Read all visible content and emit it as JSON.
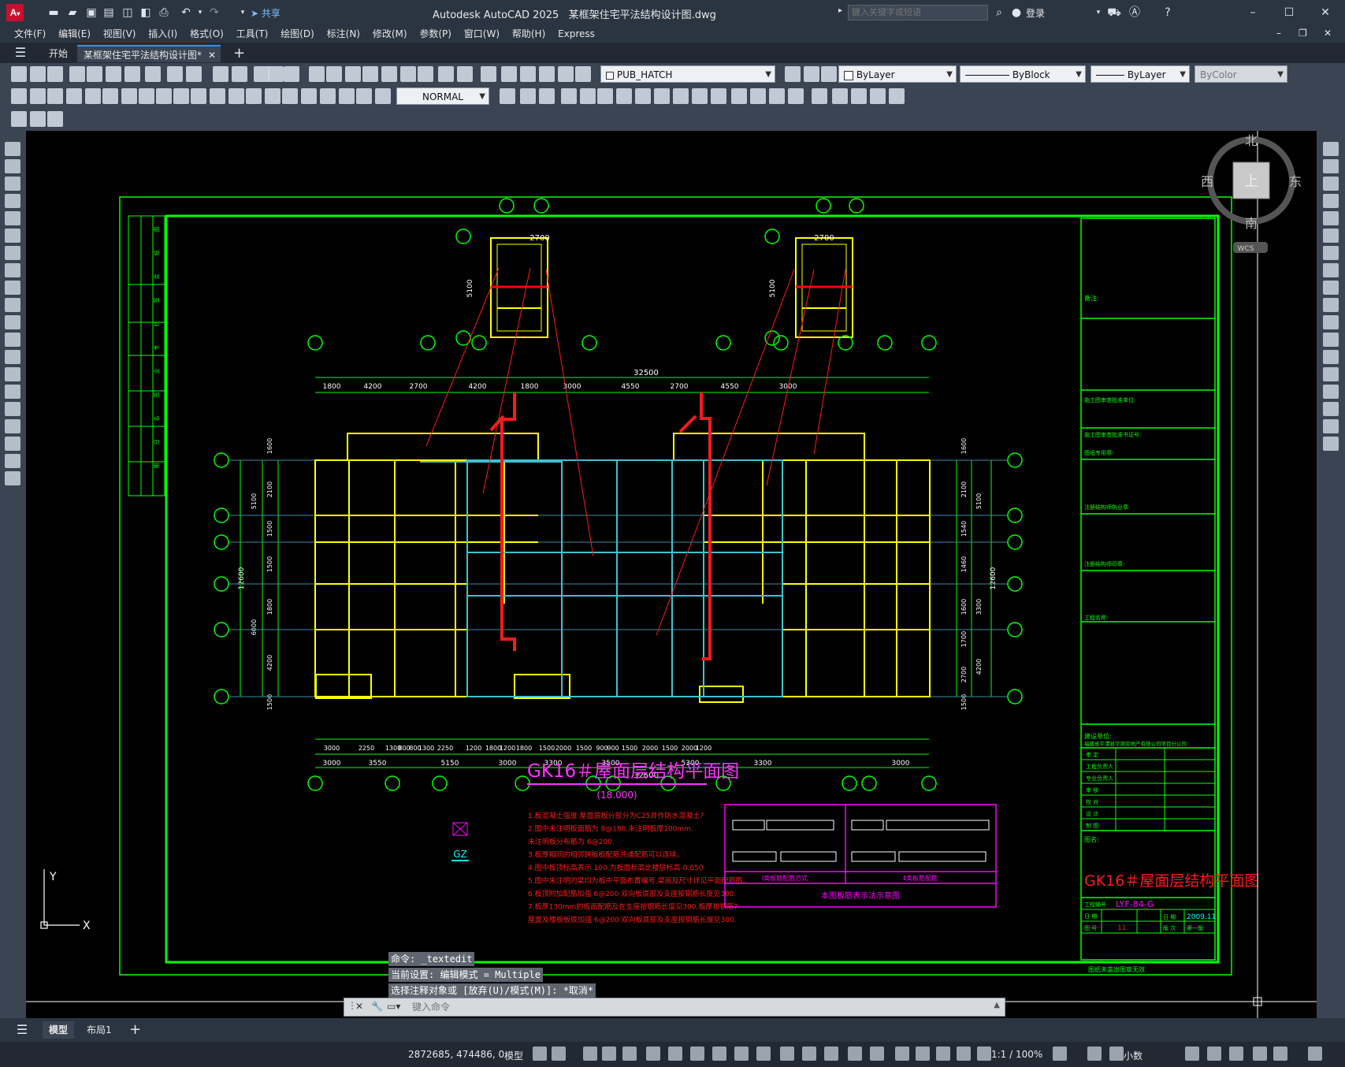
{
  "app": {
    "title": "Autodesk AutoCAD 2025",
    "file_name": "某框架住宅平法结构设计图.dwg",
    "share_label": "共享",
    "search_placeholder": "键入关键字或短语",
    "login_label": "登录"
  },
  "menu": [
    "文件(F)",
    "编辑(E)",
    "视图(V)",
    "插入(I)",
    "格式(O)",
    "工具(T)",
    "绘图(D)",
    "标注(N)",
    "修改(M)",
    "参数(P)",
    "窗口(W)",
    "帮助(H)",
    "Express"
  ],
  "tabs": {
    "start": "开始",
    "doc": "某框架住宅平法结构设计图*"
  },
  "toolbar": {
    "layer": "PUB_HATCH",
    "color": "ByLayer",
    "linetype": "ByBlock",
    "lineweight": "ByLayer",
    "plotstyle": "ByColor",
    "textstyle": "NORMAL"
  },
  "viewcube": {
    "north": "北",
    "south": "南",
    "east": "东",
    "west": "西",
    "top": "上",
    "wcs": "WCS"
  },
  "drawing": {
    "title": "GK16＃屋面层结构平面图",
    "elevation": "(18.000)",
    "total_dim": "32500",
    "top_dims": [
      "1800",
      "4200",
      "2700",
      "4200",
      "1800",
      "3000",
      "4550",
      "2700",
      "4550",
      "3000"
    ],
    "bottom_dims_1": [
      "3000",
      "2250",
      "1300",
      "800",
      "800",
      "1300",
      "2250",
      "1200",
      "1800",
      "1200",
      "1800",
      "1500",
      "2000",
      "1500",
      "900",
      "900",
      "1500",
      "2000",
      "1500",
      "2000",
      "1200"
    ],
    "bottom_dims_2": [
      "3000",
      "3550",
      "5150",
      "3000",
      "3300",
      "3500",
      "5300",
      "3300",
      "3000"
    ],
    "left_dims": [
      "1600",
      "2100",
      "1500",
      "1500",
      "1800",
      "4200",
      "1500"
    ],
    "left_dims_2": [
      "5100",
      "6000"
    ],
    "left_total": "12600",
    "right_dims": [
      "1600",
      "2100",
      "1540",
      "1460",
      "1600",
      "1700",
      "2700",
      "1500"
    ],
    "right_dims_2": [
      "5100",
      "3300",
      "4200"
    ],
    "right_total": "12600",
    "stair_dims": [
      "2700",
      "5100"
    ],
    "gz_label": "GZ",
    "notes": [
      "1.板混凝土强度:屋面层板分部分为C25并作防水混凝土?",
      "2.图中未注明板面筋为 8@180,未注明板厚100mm.",
      "  未注明板分布筋为 6@200.",
      "3.板厚相同的相邻跨板板配筋共通配筋可以连续。",
      "4.图中板顶标高表示 100 为板面标高比楼层标高-0.050",
      "5.图中未注明的梁均为板中平面布置编号,梁高及尺寸详见平面配筋图。",
      "6.板顶附加配筋加强 6@200 双向板底部及支座按钢筋长度见300.",
      "7.板厚130mm的板面配筋及在支座按钢筋长度见300,板厚按钢筋?",
      "  屋面及楼板板底加强 6@200 双向板底部及支座按钢筋长度见300."
    ],
    "legend_caption": "本图板筋表示法示意图",
    "legend_left": "Ⅰ类板筋配筋方式",
    "legend_right": "Ⅱ类板筋配筋",
    "titleblock": {
      "note_label": "备注:",
      "fields": [
        "施工图审查批准单位:",
        "施工图审查批准书证号:",
        "图纸专用章:",
        "注册结构师执业章:",
        "注册结构师印章:",
        "工程名称:"
      ],
      "company_label": "建设单位:",
      "company": "福建省平潭县华源房地产有限公司项目分公司",
      "roles": [
        "审 定",
        "工程负责人",
        "专业负责人",
        "审 核",
        "校 对",
        "设 计",
        "制 图"
      ],
      "drawing_name_label": "图名:",
      "drawing_name": "GK16＃屋面层结构平面图",
      "project_no_label": "工程编号",
      "project_no": "LYF-84-G",
      "date_label": "日 期",
      "date": "2009.11",
      "sheet_label": "图 号",
      "sheet": "11",
      "version_label": "版 次",
      "version": "第一版",
      "footer": "图纸未盖出图章无效"
    },
    "side_strip": [
      "图",
      "纸",
      "会",
      "签",
      "栏",
      "专",
      "业",
      "签",
      "名",
      "日",
      "期"
    ]
  },
  "command": {
    "line1": "命令: _textedit",
    "line2": "当前设置: 编辑模式 = Multiple",
    "line3": "选择注释对象或 [放弃(U)/模式(M)]: *取消*",
    "placeholder": "键入命令"
  },
  "ucs": {
    "x": "X",
    "y": "Y"
  },
  "layout_tabs": [
    "模型",
    "布局1"
  ],
  "status": {
    "coords": "2872685, 474486, 0",
    "model": "模型",
    "scale": "1:1 / 100%",
    "units": "小数"
  }
}
